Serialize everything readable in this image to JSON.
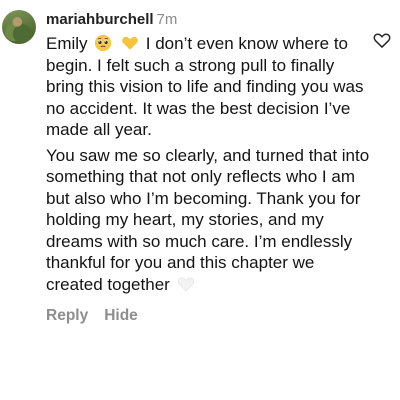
{
  "comment": {
    "username": "mariahburchell",
    "time": "7m",
    "paragraph1_part1": "Emily",
    "paragraph1_part2": "I don’t even know where to begin. I felt such a strong pull to finally bring this vision to life and finding you was no accident. It was the best decision I’ve made all year.",
    "paragraph2": "You saw me so clearly, and turned that into something that not only reflects who I am but also who I’m becoming. Thank you for holding my heart, my stories, and my dreams with so much care. I’m endlessly thankful for you and this chapter we created together",
    "emojis": [
      "pleading-face-emoji",
      "yellow-heart-emoji",
      "white-heart-emoji"
    ]
  },
  "actions": {
    "reply": "Reply",
    "hide": "Hide"
  },
  "icons": {
    "like": "heart-outline-icon"
  },
  "colors": {
    "username": "#222222",
    "secondary_text": "#8e8e8e",
    "yellow_heart": "#f6c33b"
  }
}
